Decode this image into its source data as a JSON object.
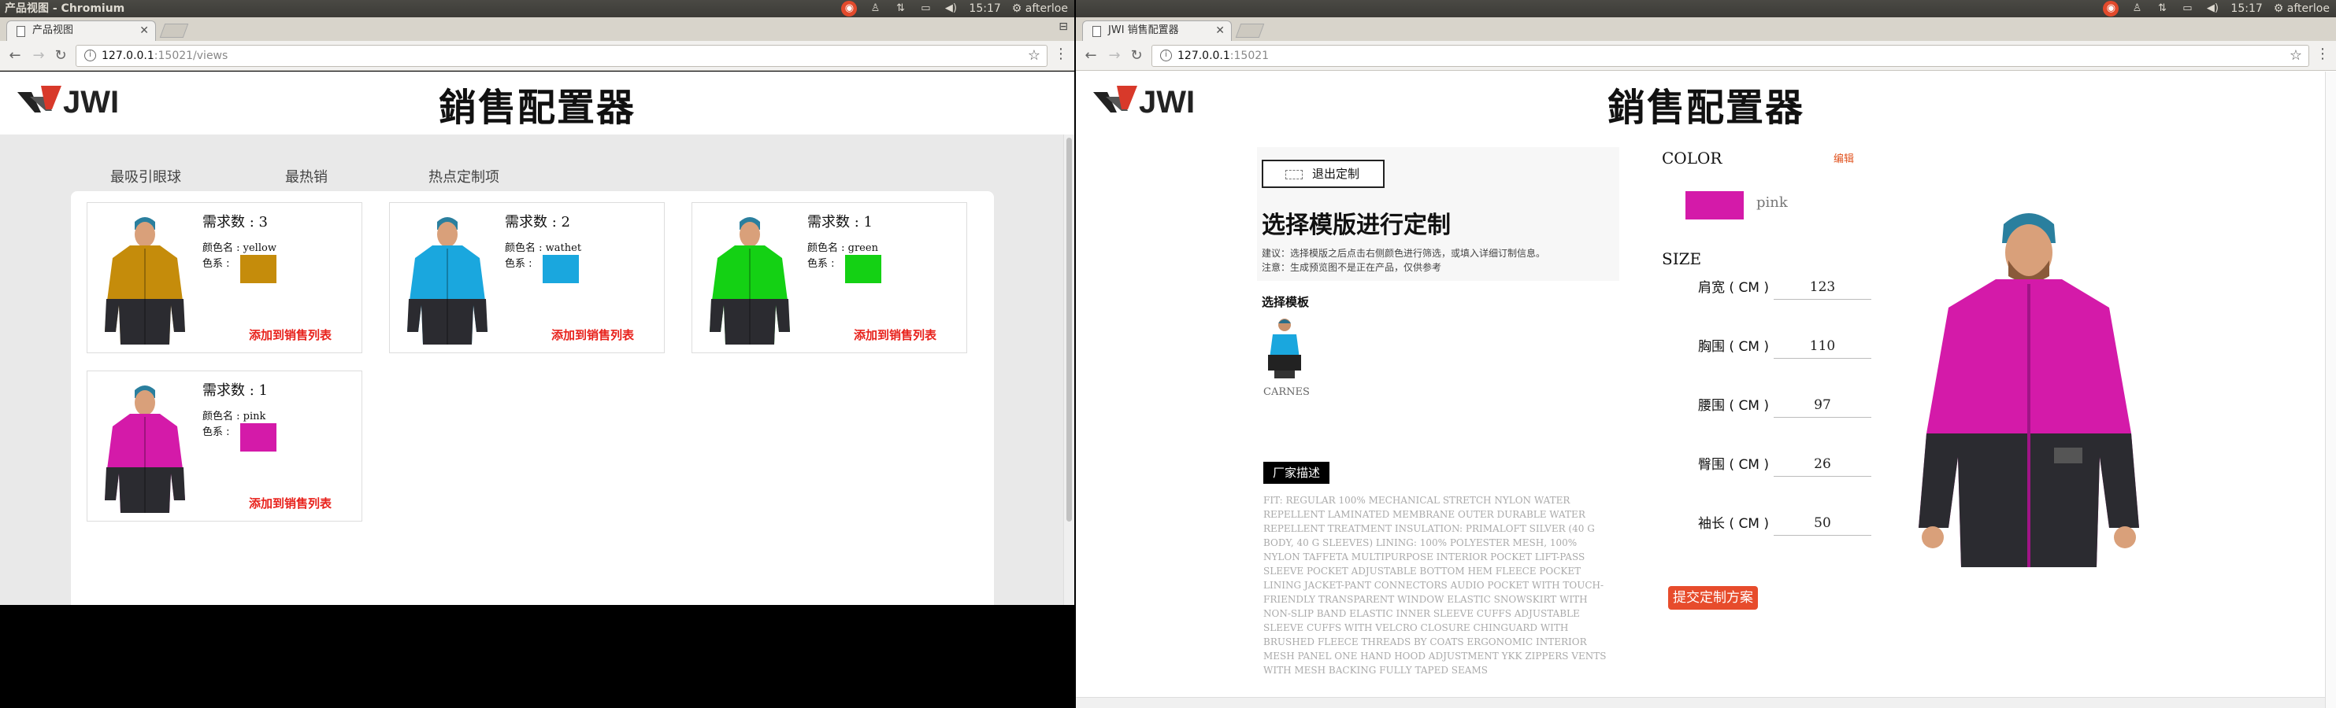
{
  "left_window": {
    "os_title": "产品视图 - Chromium",
    "tab_title": "产品视图",
    "url_host": "127.0.0.1",
    "url_rest": ":15021/views",
    "site_title": "銷售配置器",
    "tabs": [
      "最吸引眼球",
      "最热销",
      "热点定制项"
    ],
    "active_tab": "热点定制项",
    "cards": [
      {
        "count": "需求数 : 3",
        "color_name": "颜色名 : yellow",
        "swatch_label": "色系 :",
        "swatch": "#c58c0b",
        "body": "#c58c0b",
        "add": "添加到销售列表"
      },
      {
        "count": "需求数 : 2",
        "color_name": "颜色名 : wathet",
        "swatch_label": "色系 :",
        "swatch": "#1aa7de",
        "body": "#1aa7de",
        "add": "添加到销售列表"
      },
      {
        "count": "需求数 : 1",
        "color_name": "颜色名 : green",
        "swatch_label": "色系 :",
        "swatch": "#14d114",
        "body": "#14d114",
        "add": "添加到销售列表"
      },
      {
        "count": "需求数 : 1",
        "color_name": "颜色名 : pink",
        "swatch_label": "色系 :",
        "swatch": "#d41aa9",
        "body": "#d41aa9",
        "add": "添加到销售列表"
      }
    ]
  },
  "right_window": {
    "tab_title": "JWI 销售配置器",
    "url_host": "127.0.0.1",
    "url_rest": ":15021",
    "site_title": "銷售配置器",
    "exit_button": "退出定制",
    "heading": "选择模版进行定制",
    "tip1": "建议：选择模版之后点击右侧颜色进行筛选，或填入详细订制信息。",
    "tip2": "注意：生成预览图不是正在产品，仅供参考",
    "select_template_label": "选择模板",
    "template_name": "CARNES",
    "manufacturer_button": "厂家描述",
    "description": "FIT: REGULAR 100% MECHANICAL STRETCH NYLON WATER REPELLENT LAMINATED MEMBRANE OUTER DURABLE WATER REPELLENT TREATMENT INSULATION: PRIMALOFT SILVER (40 G BODY, 40 G SLEEVES) LINING: 100% POLYESTER MESH, 100% NYLON TAFFETA MULTIPURPOSE INTERIOR POCKET LIFT-PASS SLEEVE POCKET ADJUSTABLE BOTTOM HEM FLEECE POCKET LINING JACKET-PANT CONNECTORS AUDIO POCKET WITH TOUCH-FRIENDLY TRANSPARENT WINDOW ELASTIC SNOWSKIRT WITH NON-SLIP BAND ELASTIC INNER SLEEVE CUFFS ADJUSTABLE SLEEVE CUFFS WITH VELCRO CLOSURE CHINGUARD WITH BRUSHED FLEECE THREADS BY COATS ERGONOMIC INTERIOR MESH PANEL ONE HAND HOOD ADJUSTMENT YKK ZIPPERS VENTS WITH MESH BACKING FULLY TAPED SEAMS",
    "color_heading": "COLOR",
    "edit_link": "编辑",
    "color_name": "pink",
    "color_hex": "#d41aa9",
    "size_heading": "SIZE",
    "sizes": [
      {
        "label": "肩宽 ( CM )",
        "value": "123"
      },
      {
        "label": "胸围 ( CM )",
        "value": "110"
      },
      {
        "label": "腰围 ( CM )",
        "value": "97"
      },
      {
        "label": "臀围 ( CM )",
        "value": "26"
      },
      {
        "label": "袖长 ( CM )",
        "value": "50"
      }
    ],
    "submit_button": "提交定制方案"
  },
  "system": {
    "time": "15:17",
    "user": "afterloe"
  }
}
